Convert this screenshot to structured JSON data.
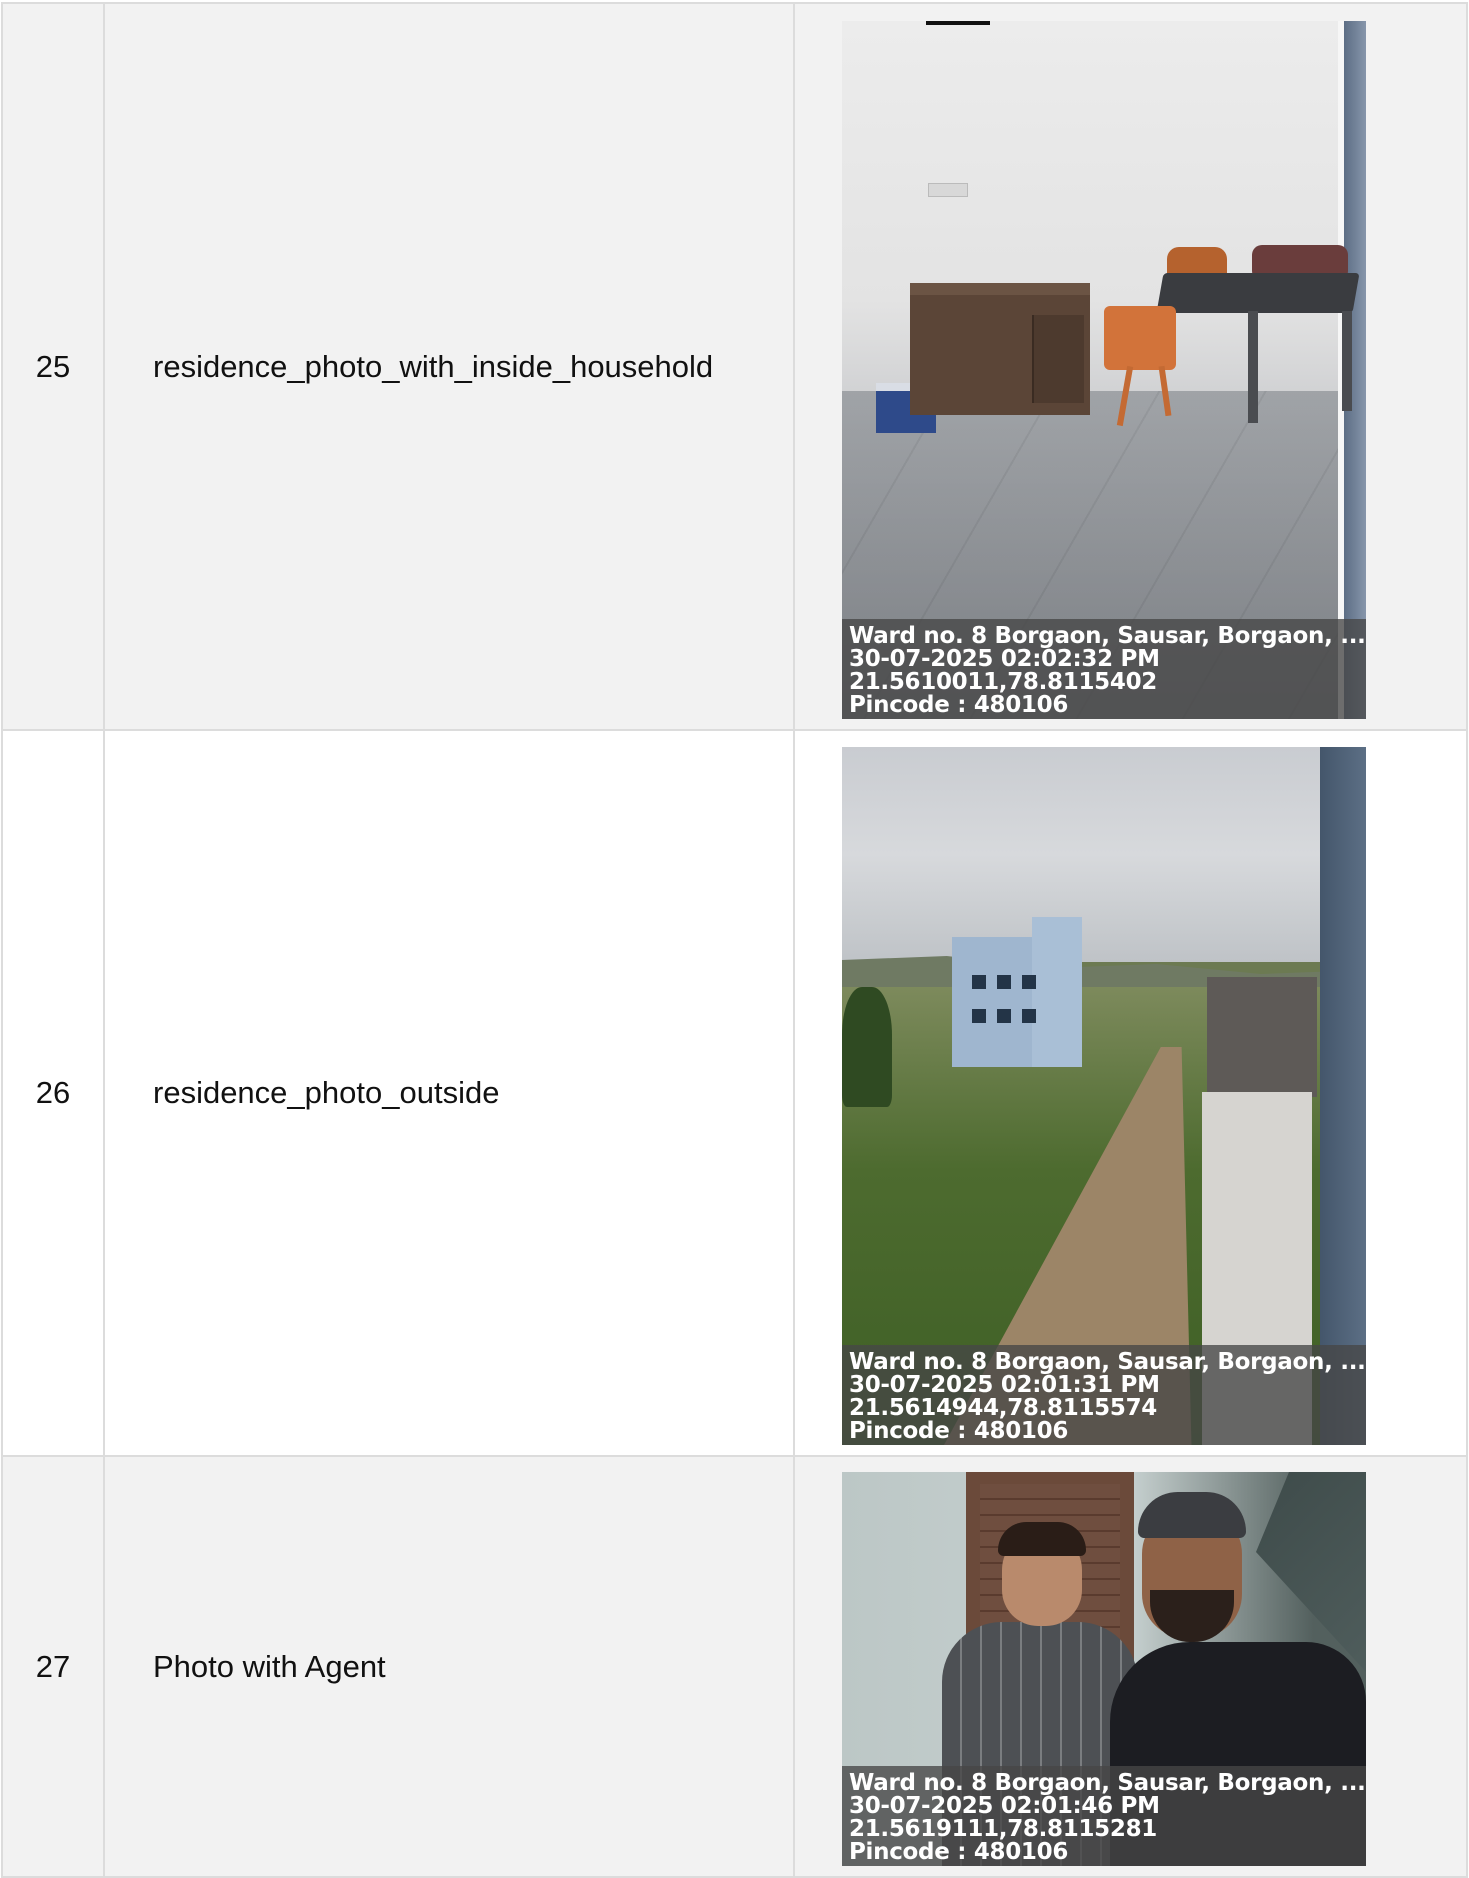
{
  "rows": [
    {
      "index": "25",
      "label": "residence_photo_with_inside_household",
      "overlay": {
        "address": "Ward no. 8 Borgaon, Sausar, Borgaon, ...",
        "datetime": "30-07-2025 02:02:32 PM",
        "coords": "21.5610011,78.8115402",
        "pincode": "Pincode : 480106"
      }
    },
    {
      "index": "26",
      "label": "residence_photo_outside",
      "overlay": {
        "address": "Ward no. 8 Borgaon, Sausar, Borgaon, ...",
        "datetime": "30-07-2025 02:01:31 PM",
        "coords": "21.5614944,78.8115574",
        "pincode": "Pincode : 480106"
      }
    },
    {
      "index": "27",
      "label": "Photo with Agent",
      "overlay": {
        "address": "Ward no. 8 Borgaon, Sausar, Borgaon, ...",
        "datetime": "30-07-2025 02:01:46 PM",
        "coords": "21.5619111,78.8115281",
        "pincode": "Pincode : 480106"
      }
    }
  ]
}
